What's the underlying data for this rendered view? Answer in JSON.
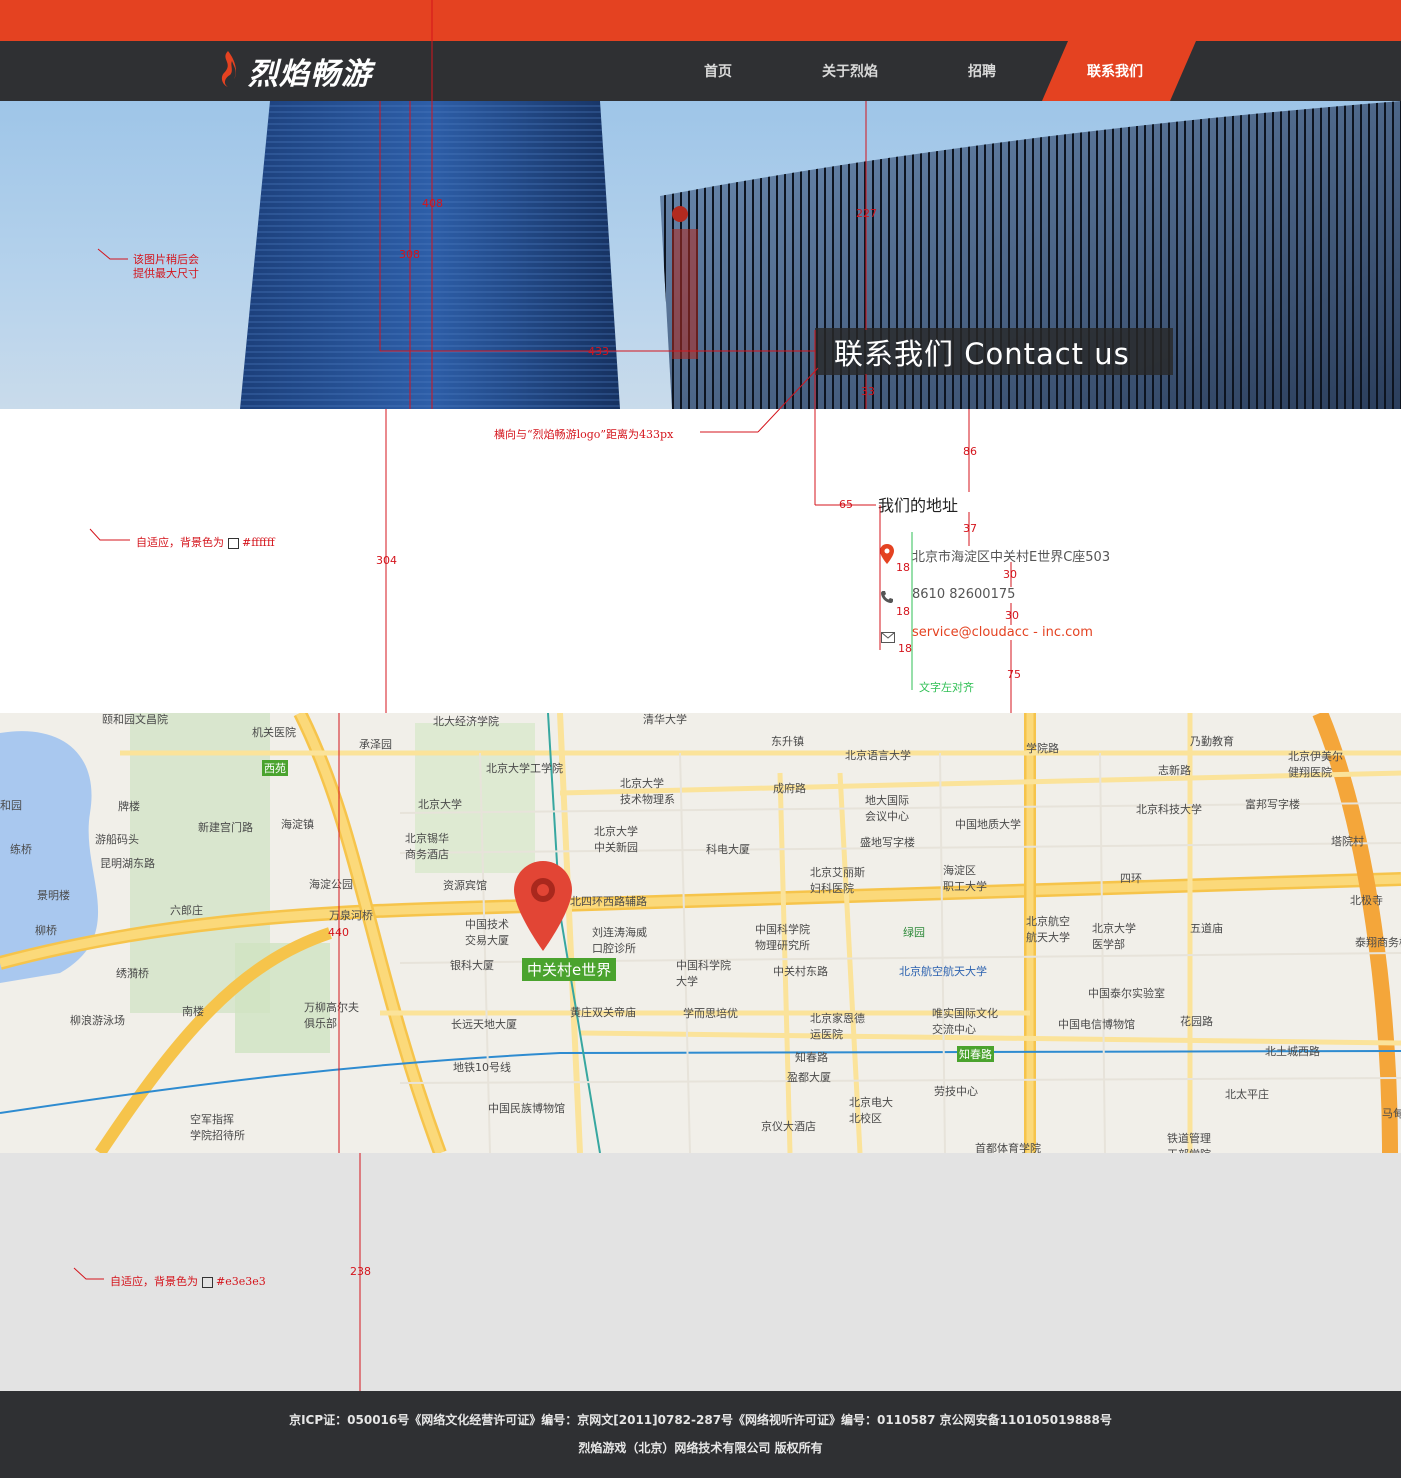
{
  "brand": {
    "name": "烈焰畅游"
  },
  "nav": {
    "items": [
      {
        "label": "首页"
      },
      {
        "label": "关于烈焰"
      },
      {
        "label": "招聘"
      },
      {
        "label": "联系我们"
      }
    ]
  },
  "hero": {
    "title": "联系我们 Contact us"
  },
  "contact": {
    "heading": "我们的地址",
    "address": "北京市海淀区中关村E世界C座503",
    "phone": "8610  82600175",
    "email": "service@cloudacc - inc.com"
  },
  "map": {
    "marker_label": "中关村e世界",
    "places": [
      "北京大学工学院",
      "北大经济学院",
      "清华大学",
      "北京大学",
      "北京大学技术物理系",
      "成府路",
      "北京语言大学",
      "学院路",
      "志新路",
      "北京伊美尔健翔医院",
      "机关医院",
      "承泽园",
      "西苑",
      "颐和园文昌院",
      "牌楼",
      "新建宫门路",
      "海淀镇",
      "游船码头",
      "昆明湖东路",
      "北京锡华商务酒店",
      "北京大学中关新园",
      "科电大厦",
      "地大国际会议中心",
      "中国地质大学",
      "北京科技大学",
      "富邦写字楼",
      "塔院村",
      "练桥",
      "景明楼",
      "六郎庄",
      "海淀公园",
      "资源宾馆",
      "北京艾丽斯妇科医院",
      "海淀区职工大学",
      "四环",
      "北四环西路辅路",
      "万泉河桥",
      "中国技术交易大厦",
      "刘连涛海威口腔诊所",
      "中国科学院物理研究所",
      "北京航空航天大学",
      "北京大学医学部",
      "五道庙",
      "北极寺",
      "泰翔商务楼",
      "银科大厦",
      "中国科学院大学",
      "中关村东路",
      "北京航空航天大学",
      "绿园",
      "柳浪游泳场",
      "万柳高尔夫俱乐部",
      "南楼",
      "长远天地大厦",
      "黄庄双关帝庙",
      "学而思培优",
      "北京家恩德运医院",
      "唯实国际文化交流中心",
      "中国电信博物馆",
      "中国泰尔实验室",
      "花园路",
      "知春路",
      "北土城西路",
      "地铁10号线",
      "盈都大厦",
      "劳技中心",
      "北太平庄",
      "中国民族博物馆",
      "北京电大北校区",
      "空军指挥学院招待所",
      "京仪大酒店",
      "首都体育学院",
      "铁道管理干部学院",
      "马甸",
      "乃勤教育",
      "东升镇",
      "绣漪桥",
      "柳桥",
      "和园",
      "北京大学医学部"
    ]
  },
  "annotations": {
    "hero_note": "该图片稍后会\n提供最大尺寸",
    "logo_distance": "横向与“烈焰畅游logo”距离为433px",
    "white_bg": "自适应，背景色为",
    "white_hex": "#ffffff",
    "grey_bg": "自适应，背景色为",
    "grey_hex": "#e3e3e3",
    "left_align": "文字左对齐",
    "measure_408": "408",
    "measure_308": "308",
    "measure_433": "433",
    "measure_227": "227",
    "measure_33": "33",
    "measure_86": "86",
    "measure_65": "65",
    "measure_37": "37",
    "measure_304": "304",
    "measure_18a": "18",
    "measure_18b": "18",
    "measure_18c": "18",
    "measure_30a": "30",
    "measure_30b": "30",
    "measure_75": "75",
    "measure_440": "440",
    "measure_238": "238"
  },
  "footer": {
    "line1": "京ICP证：050016号《网络文化经营许可证》编号：京网文[2011]0782-287号《网络视听许可证》编号：0110587 京公网安备110105019888号",
    "line2": "烈焰游戏（北京）网络技术有限公司 版权所有"
  },
  "colors": {
    "accent": "#e44221",
    "nav_bg": "#2f3033",
    "grey_bg": "#e3e3e3",
    "white_bg": "#ffffff",
    "map_pin": "#e24535",
    "map_label": "#4aa32e"
  },
  "icons": [
    "flame-logo-icon",
    "location-pin-icon",
    "phone-icon",
    "mail-icon",
    "map-marker-icon"
  ]
}
